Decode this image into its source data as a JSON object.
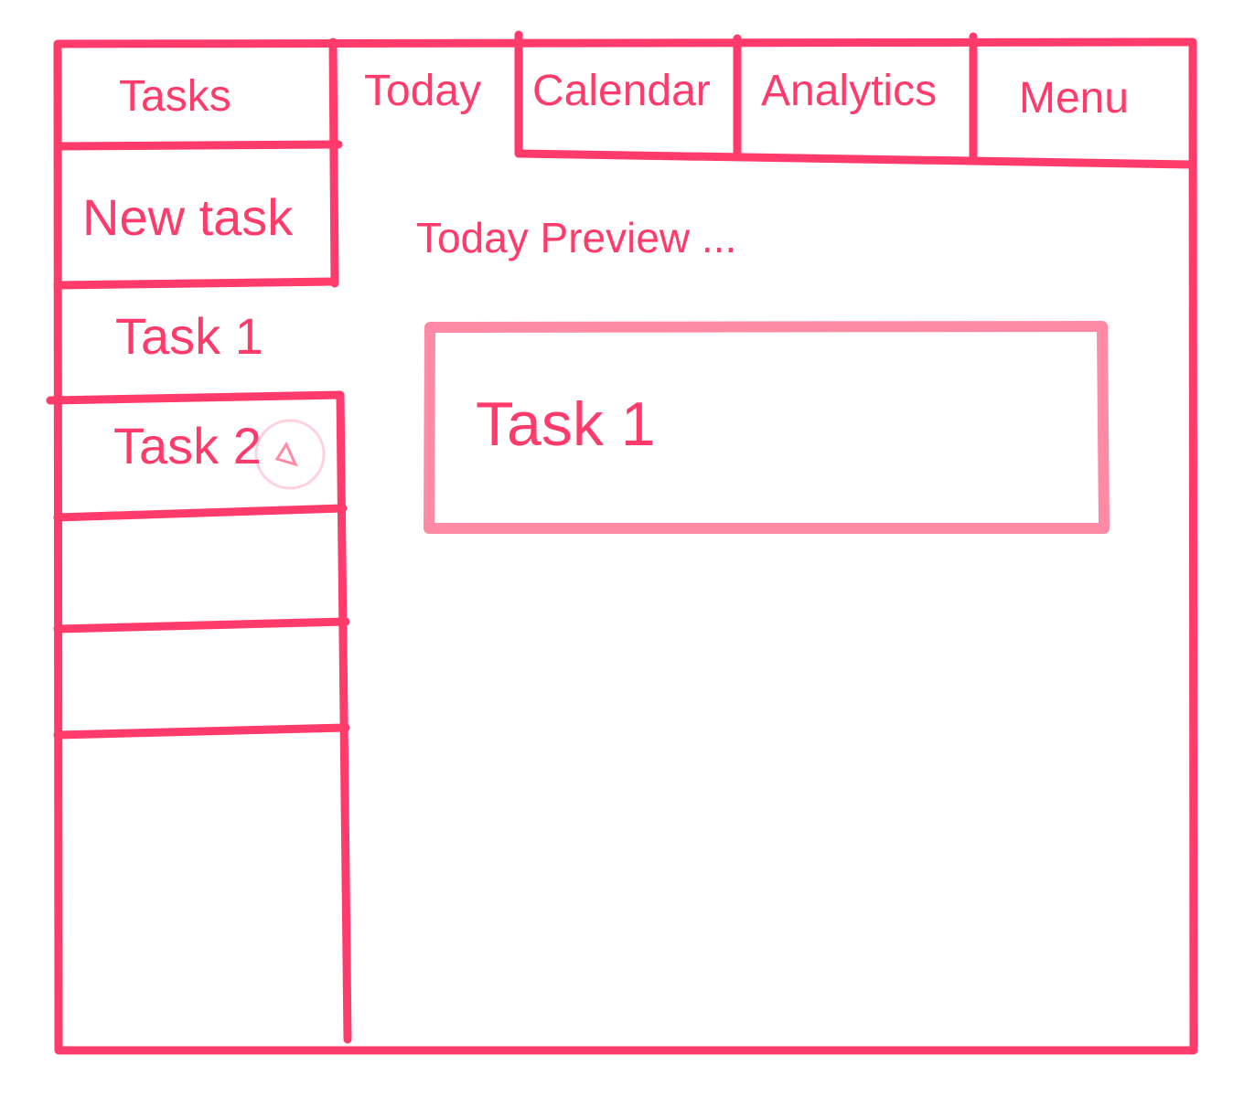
{
  "colors": {
    "ink": "#ff3b6b",
    "card_border": "#ff8aa5",
    "cursor": "#ffd1dc"
  },
  "tabs": [
    {
      "id": "tasks",
      "label": "Tasks"
    },
    {
      "id": "today",
      "label": "Today",
      "active": true
    },
    {
      "id": "calendar",
      "label": "Calendar"
    },
    {
      "id": "analytics",
      "label": "Analytics"
    },
    {
      "id": "menu",
      "label": "Menu"
    }
  ],
  "sidebar": {
    "new_task_label": "New task",
    "items": [
      {
        "label": "Task 1",
        "selected": true
      },
      {
        "label": "Task 2"
      },
      {
        "label": ""
      },
      {
        "label": ""
      }
    ]
  },
  "main": {
    "preview_heading": "Today Preview ...",
    "card": {
      "title": "Task 1"
    }
  },
  "cursor_icon": "pointer-cursor-icon"
}
